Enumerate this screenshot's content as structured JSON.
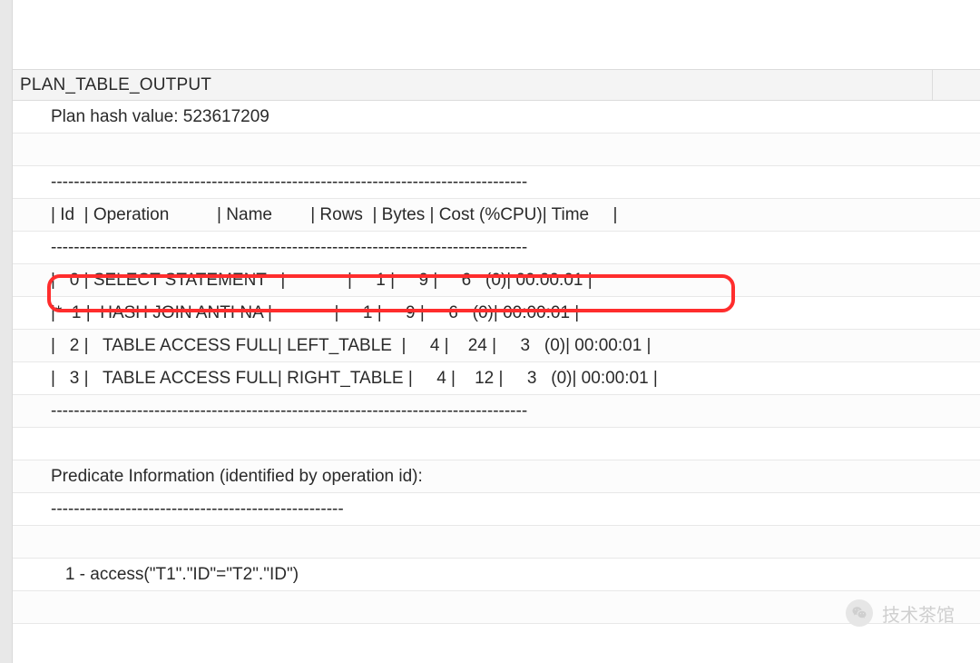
{
  "header": {
    "column_label": "PLAN_TABLE_OUTPUT"
  },
  "plan": {
    "hash_line": "Plan hash value: 523617209",
    "divider": "-----------------------------------------------------------------------------------",
    "columns_line": "| Id  | Operation          | Name        | Rows  | Bytes | Cost (%CPU)| Time     |",
    "rows": [
      "|   0 | SELECT STATEMENT   |             |     1 |     9 |     6   (0)| 00:00:01 |",
      "|*  1 |  HASH JOIN ANTI NA |             |     1 |     9 |     6   (0)| 00:00:01 |",
      "|   2 |   TABLE ACCESS FULL| LEFT_TABLE  |     4 |    24 |     3   (0)| 00:00:01 |",
      "|   3 |   TABLE ACCESS FULL| RIGHT_TABLE |     4 |    12 |     3   (0)| 00:00:01 |"
    ],
    "predicate_header": "Predicate Information (identified by operation id):",
    "predicate_divider": "---------------------------------------------------",
    "predicate_line": "   1 - access(\"T1\".\"ID\"=\"T2\".\"ID\")"
  },
  "watermark": {
    "text": "技术茶馆"
  },
  "highlight_color": "#ff2d2d"
}
